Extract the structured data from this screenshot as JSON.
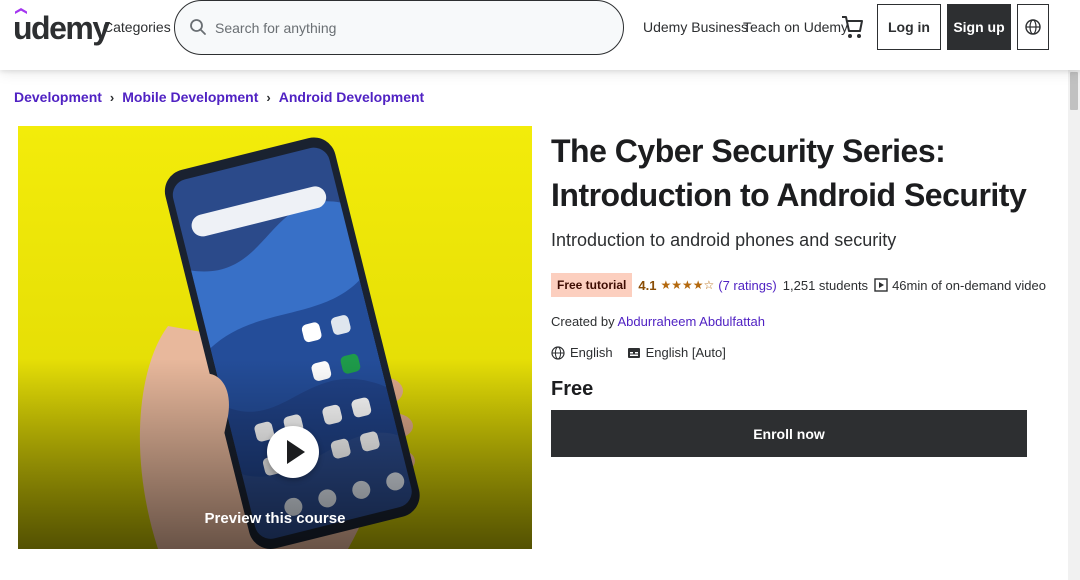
{
  "header": {
    "logo_text": "udemy",
    "categories_label": "Categories",
    "search_placeholder": "Search for anything",
    "business_label": "Udemy Business",
    "teach_label": "Teach on Udemy",
    "login_label": "Log in",
    "signup_label": "Sign up"
  },
  "breadcrumb": {
    "items": [
      "Development",
      "Mobile Development",
      "Android Development"
    ],
    "separator": "›"
  },
  "preview": {
    "label": "Preview this course"
  },
  "course": {
    "title": "The Cyber Security Series: Introduction to Android Security",
    "subtitle": "Introduction to android phones and security",
    "badge": "Free tutorial",
    "rating": "4.1",
    "stars": "★★★★☆",
    "ratings_count": "(7 ratings)",
    "students": "1,251 students",
    "video_length": "46min of on-demand video",
    "created_by_label": "Created by",
    "author": "Abdurraheem Abdulfattah",
    "language": "English",
    "captions": "English [Auto]",
    "price": "Free",
    "enroll_label": "Enroll now"
  },
  "colors": {
    "brand_purple": "#5022c3",
    "dark": "#2d2f31",
    "badge_bg": "#fccfbf",
    "star": "#b4690e",
    "preview_bg": "#f3ec0a"
  },
  "icons": [
    "search-icon",
    "cart-icon",
    "globe-icon",
    "video-icon",
    "captions-icon",
    "play-icon"
  ]
}
